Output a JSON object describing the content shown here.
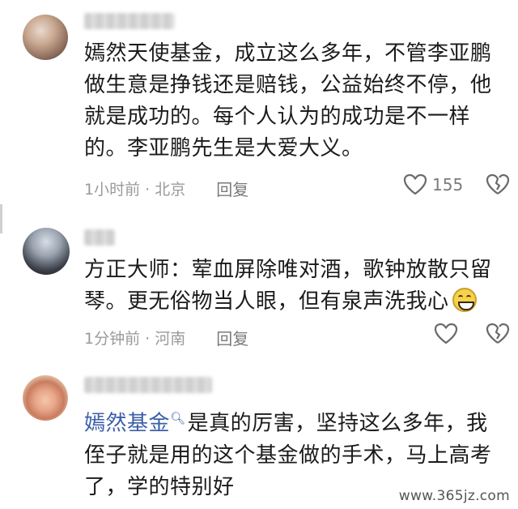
{
  "comments": [
    {
      "text": "嫣然天使基金，成立这么多年，不管李亚鹏做生意是挣钱还是赔钱，公益始终不停，他就是成功的。每个人认为的成功是不一样的。李亚鹏先生是大爱大义。",
      "time_location": "1小时前 · 北京",
      "reply_label": "回复",
      "like_count": "155"
    },
    {
      "text": "方正大师：荤血屏除唯对酒，歌钟放散只留琴。更无俗物当人眼，但有泉声洗我心",
      "emoji": "grin-emoji",
      "time_location": "1分钟前 · 河南",
      "reply_label": "回复",
      "like_count": ""
    },
    {
      "link_text": "嫣然基金",
      "text": "是真的厉害，坚持这么多年，我侄子就是用的这个基金做的手术，马上高考了，学的特别好"
    }
  ],
  "watermark": "www.365jz.com",
  "colors": {
    "link": "#3a5ea8",
    "meta": "#9a9a9a",
    "text": "#1b1b1b"
  }
}
